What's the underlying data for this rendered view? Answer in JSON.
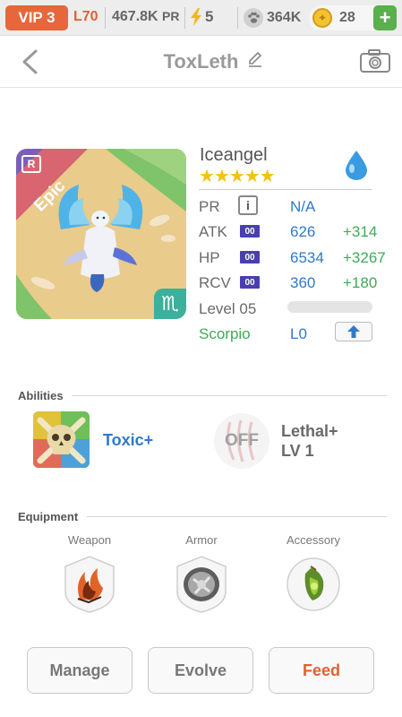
{
  "topbar": {
    "vip": "VIP 3",
    "level": "L70",
    "pr_value": "467.8K",
    "pr_unit": "PR",
    "energy": "5",
    "paws": "364K",
    "coins": "28",
    "add_label": "+"
  },
  "header": {
    "back_icon": "chevron-left-icon",
    "title": "ToxLeth",
    "edit_icon": "pencil-icon",
    "camera_icon": "camera-icon"
  },
  "card": {
    "rarity": "Epic",
    "badge": "R",
    "zodiac_symbol": "♏",
    "bg_color": "#e8c98a",
    "ribbon_color": "#d96570"
  },
  "creature": {
    "name": "Iceangel",
    "stars": "★★★★★",
    "element_icon": "water-drop-icon"
  },
  "stats": {
    "pr_label": "PR",
    "pr_info": "i",
    "pr_value": "N/A",
    "atk_label": "ATK",
    "atk_chip": "00",
    "atk_value": "626",
    "atk_bonus": "+314",
    "hp_label": "HP",
    "hp_chip": "00",
    "hp_value": "6534",
    "hp_bonus": "+3267",
    "rcv_label": "RCV",
    "rcv_chip": "00",
    "rcv_value": "360",
    "rcv_bonus": "+180",
    "level_label": "Level 05",
    "xp_fraction": 0,
    "zodiac_label": "Scorpio",
    "zodiac_level": "L0",
    "upgrade_icon": "arrow-up-icon"
  },
  "abilities": {
    "heading": "Abilities",
    "items": [
      {
        "name": "Toxic+",
        "icon": "skull-icon"
      },
      {
        "name": "Lethal+",
        "level": "LV 1",
        "status": "OFF",
        "icon": "claw-icon"
      }
    ]
  },
  "equipment": {
    "heading": "Equipment",
    "slots": [
      {
        "label": "Weapon",
        "icon": "fire-claw-icon"
      },
      {
        "label": "Armor",
        "icon": "armor-shield-icon"
      },
      {
        "label": "Accessory",
        "icon": "green-amulet-icon"
      }
    ]
  },
  "actions": {
    "manage": "Manage",
    "evolve": "Evolve",
    "feed": "Feed"
  },
  "colors": {
    "accent_orange": "#e0612f",
    "blue_value": "#2f79c9",
    "green_bonus": "#3cab57",
    "star_gold": "#f3c111",
    "stat_chip": "#4a3fb0"
  }
}
